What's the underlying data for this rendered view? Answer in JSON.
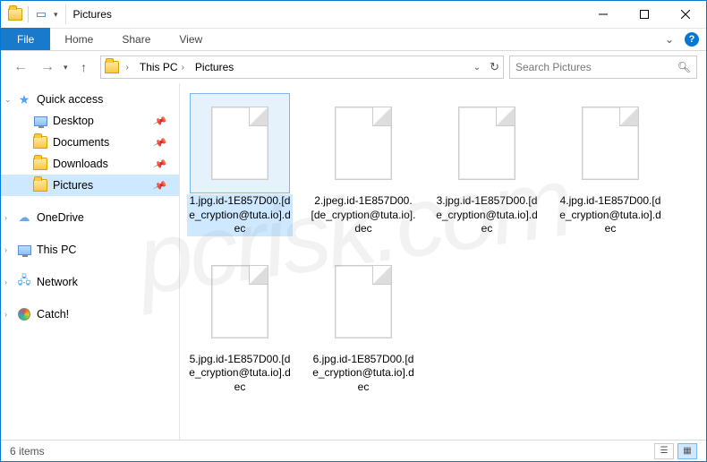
{
  "window": {
    "title": "Pictures"
  },
  "ribbon": {
    "file": "File",
    "tabs": [
      "Home",
      "Share",
      "View"
    ]
  },
  "breadcrumb": {
    "items": [
      "This PC",
      "Pictures"
    ]
  },
  "search": {
    "placeholder": "Search Pictures"
  },
  "sidebar": {
    "quick_access": "Quick access",
    "pinned": [
      {
        "label": "Desktop"
      },
      {
        "label": "Documents"
      },
      {
        "label": "Downloads"
      },
      {
        "label": "Pictures",
        "selected": true
      }
    ],
    "roots": [
      {
        "label": "OneDrive",
        "icon": "cloud"
      },
      {
        "label": "This PC",
        "icon": "monitor"
      },
      {
        "label": "Network",
        "icon": "net"
      },
      {
        "label": "Catch!",
        "icon": "disc"
      }
    ]
  },
  "files": [
    {
      "name": "1.jpg.id-1E857D00.[de_cryption@tuta.io].dec",
      "selected": true
    },
    {
      "name": "2.jpeg.id-1E857D00.[de_cryption@tuta.io].dec"
    },
    {
      "name": "3.jpg.id-1E857D00.[de_cryption@tuta.io].dec"
    },
    {
      "name": "4.jpg.id-1E857D00.[de_cryption@tuta.io].dec"
    },
    {
      "name": "5.jpg.id-1E857D00.[de_cryption@tuta.io].dec"
    },
    {
      "name": "6.jpg.id-1E857D00.[de_cryption@tuta.io].dec"
    }
  ],
  "status": {
    "count": "6 items"
  },
  "watermark": "pcrisk.com"
}
